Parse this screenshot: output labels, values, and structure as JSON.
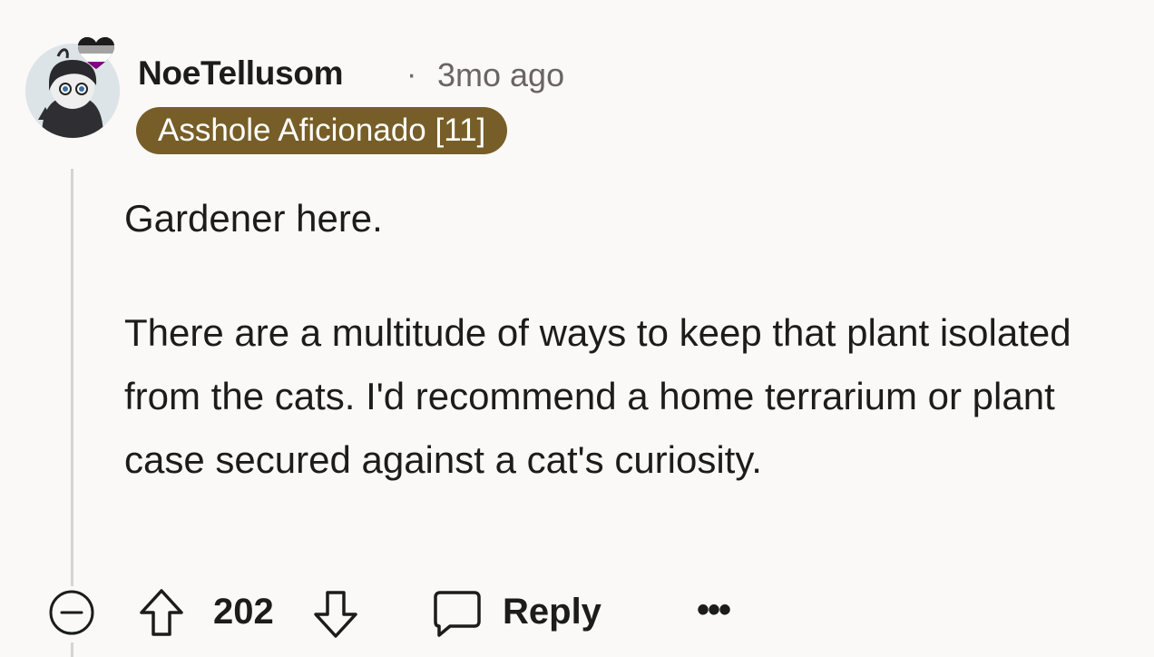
{
  "comment": {
    "username": "NoeTellusom",
    "separator": "·",
    "timestamp": "3mo ago",
    "flair": "Asshole Aficionado [11]",
    "paragraphs": [
      "Gardener here.",
      "There are a multitude of ways to keep that plant isolated from the cats. I'd recommend a home terrarium or plant case secured against a cat's curiosity."
    ]
  },
  "actions": {
    "score": "202",
    "reply_label": "Reply",
    "more_label": "•••"
  },
  "colors": {
    "flair_bg": "#775e28",
    "background": "#faf9f7",
    "thread_line": "#d6d3d0"
  },
  "icons": {
    "collapse": "minus-circle-icon",
    "upvote": "arrow-up-icon",
    "downvote": "arrow-down-icon",
    "reply": "speech-bubble-icon",
    "more": "ellipsis-icon",
    "flair_badge": "heart-icon"
  }
}
